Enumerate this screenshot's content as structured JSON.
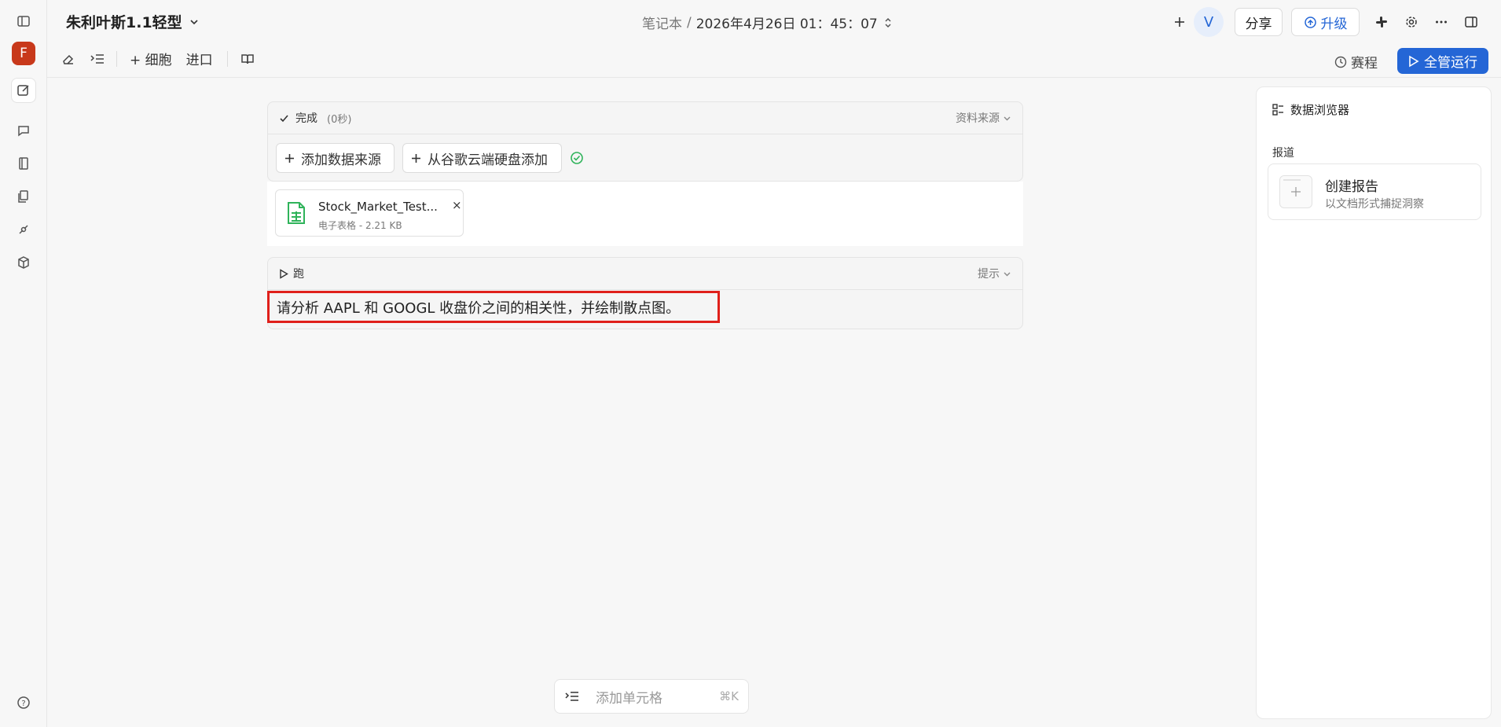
{
  "app": {
    "avatar_letter": "F",
    "notebook_title": "朱利叶斯1.1轻型",
    "breadcrumb_section": "笔记本",
    "breadcrumb_sep": "/",
    "breadcrumb_date": "2026年4月26日 01：45：07"
  },
  "header": {
    "user_initial": "V",
    "share_label": "分享",
    "upgrade_label": "升级"
  },
  "toolbar": {
    "add_cell_label": "+ 细胞",
    "import_label": "进口",
    "schedule_label": "赛程",
    "run_all_label": "全管运行"
  },
  "data_cell": {
    "status": "完成",
    "duration": "(0秒)",
    "source_label": "资料来源",
    "add_source_label": "添加数据来源",
    "add_drive_label": "从谷歌云端硬盘添加",
    "file": {
      "name": "Stock_Market_Test...",
      "meta": "电子表格 - 2.21 KB",
      "remove": "×"
    }
  },
  "run_cell": {
    "run_label": "跑",
    "hint_label": "提示",
    "prompt": "请分析 AAPL 和 GOOGL 收盘价之间的相关性，并绘制散点图。"
  },
  "right_panel": {
    "title": "数据浏览器",
    "section": "报道",
    "create_report_title": "创建报告",
    "create_report_sub": "以文档形式捕捉洞察"
  },
  "add_cell_bar": {
    "placeholder": "添加单元格",
    "shortcut": "⌘K"
  },
  "colors": {
    "brand": "#2466d6",
    "avatar": "#c8391b",
    "highlight": "#e0201b",
    "success": "#2fb35a"
  }
}
